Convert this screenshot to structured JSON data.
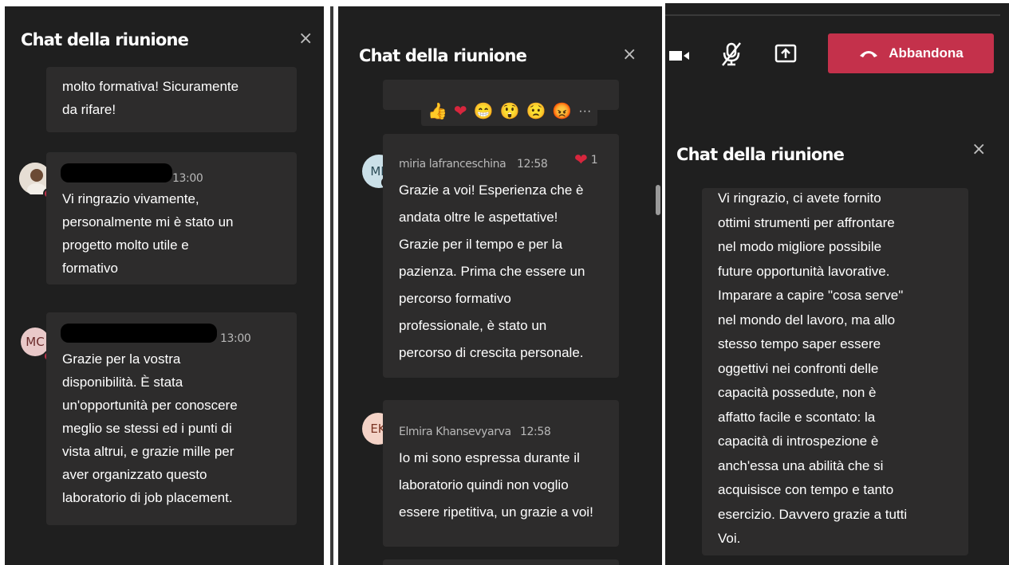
{
  "panel_left": {
    "title": "Chat della riunione",
    "close_glyph": "×",
    "top_bubble_text": "molto formativa! Sicuramente\nda rifare!",
    "message1": {
      "time": "13:00",
      "text": "Vi ringrazio vivamente,\npersonalmente mi è stato un\nprogetto molto utile e\nformativo"
    },
    "message2": {
      "avatar_initials": "MC",
      "time": "13:00",
      "text": "Grazie per la vostra\ndisponibilità. È stata\nun'opportunità per conoscere\nmeglio se stessi ed i punti di\nvista altrui, e grazie mille per\naver organizzato questo\nlaboratorio di job placement."
    }
  },
  "panel_mid": {
    "title": "Chat della riunione",
    "close_glyph": "×",
    "reactions": [
      "👍",
      "❤",
      "😁",
      "😲",
      "😟",
      "😡"
    ],
    "more_glyph": "···",
    "message1": {
      "avatar_initials": "ML",
      "sender": "miria lafranceschina",
      "time": "12:58",
      "reaction_count": "1",
      "text": "Grazie a voi! Esperienza che è\nandata oltre le aspettative!\nGrazie per il tempo e per la\npazienza. Prima che essere un\npercorso formativo\nprofessionale, è stato un\npercorso di crescita personale."
    },
    "message2": {
      "avatar_initials": "EK",
      "sender": "Elmira Khansevyarva",
      "time": "12:58",
      "text": "Io mi sono espressa durante il\nlaboratorio quindi non voglio\nessere ripetitiva, un grazie a voi!"
    }
  },
  "panel_right": {
    "leave_label": "Abbandona",
    "title": "Chat della riunione",
    "close_glyph": "×",
    "message": {
      "text": "Vi ringrazio, ci avete fornito\nottimi strumenti per affrontare\nnel modo migliore possibile\nfuture opportunità lavorative.\nImparare a capire \"cosa serve\"\nnel mondo del lavoro, ma allo\nstesso tempo saper essere\noggettivi nei confronti delle\ncapacità possedute, non è\naffatto facile e scontato: la\ncapacità di introspezione è\nanch'essa una abilità che si\nacquisisce con tempo e tanto\nesercizio. Davvero grazie a tutti\nVoi."
    }
  },
  "colors": {
    "background": "#1f1f1f",
    "bubble": "#2d2c2c",
    "accent_red": "#c4314b",
    "text": "#ffffff",
    "meta": "#b8b8b8"
  }
}
